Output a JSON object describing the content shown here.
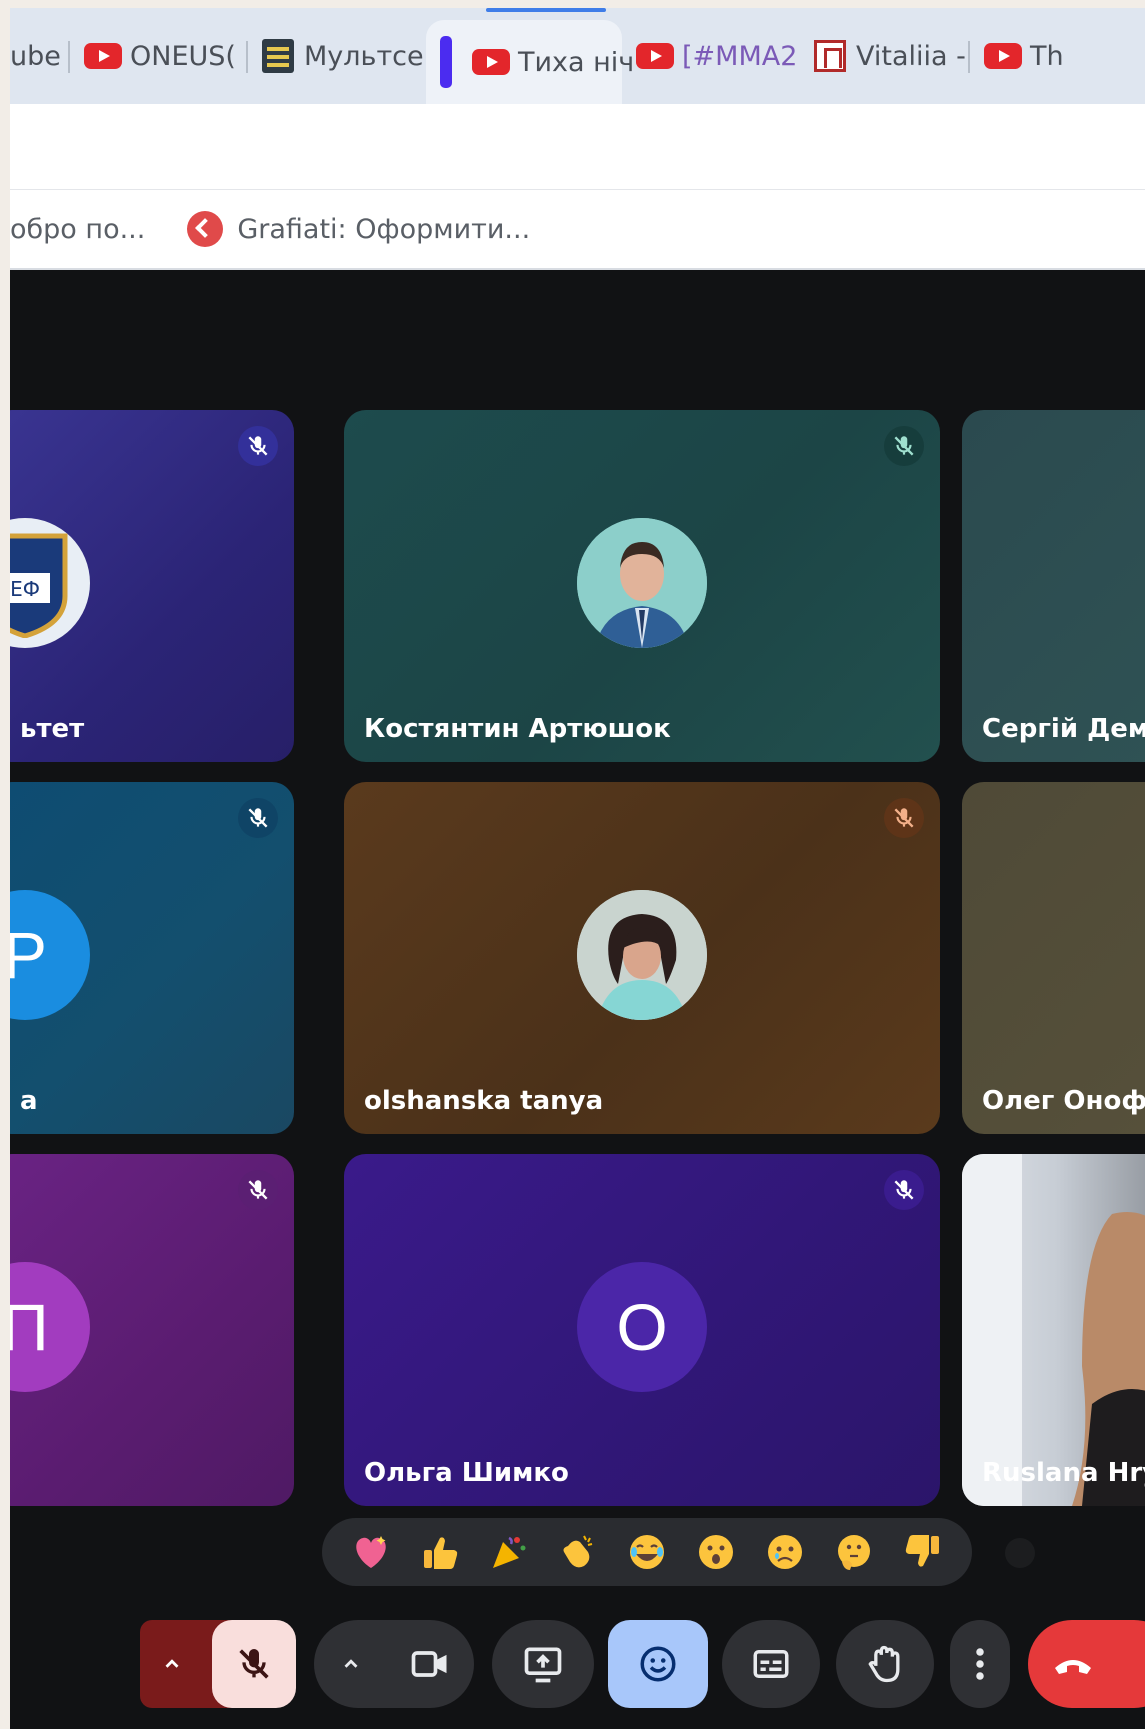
{
  "browser": {
    "tabs": [
      {
        "label": "ube",
        "icon": "none"
      },
      {
        "label": "ONEUS(",
        "icon": "youtube-icon"
      },
      {
        "label": "Мультсе",
        "icon": "doc-icon"
      },
      {
        "label": "Тиха ніч",
        "icon": "youtube-icon",
        "active": true
      },
      {
        "label": "[#MMA2",
        "icon": "youtube-icon"
      },
      {
        "label": "Vitaliia -",
        "icon": "vitaliia-icon"
      },
      {
        "label": "Th",
        "icon": "youtube-icon"
      }
    ],
    "bookmarks": [
      {
        "label": "обро по..."
      },
      {
        "label": "Grafiati: Оформити..."
      }
    ]
  },
  "meet": {
    "participants": [
      {
        "name": "ьтет",
        "avatar": "faculty-logo",
        "muted": true
      },
      {
        "name": "Костянтин Артюшок",
        "avatar": "photo",
        "muted": true
      },
      {
        "name": "Сергій Дем",
        "avatar": "none",
        "muted": true
      },
      {
        "name": "а",
        "avatar": "letter",
        "letter": "Р",
        "muted": true
      },
      {
        "name": "olshanska tanya",
        "avatar": "photo",
        "muted": true
      },
      {
        "name": "Олег Онофр",
        "avatar": "none",
        "muted": true
      },
      {
        "name": "",
        "avatar": "letter",
        "letter": "П",
        "muted": true
      },
      {
        "name": "Ольга Шимко",
        "avatar": "letter",
        "letter": "О",
        "muted": true
      },
      {
        "name": "Ruslana Hry",
        "avatar": "camera",
        "muted": false
      }
    ],
    "reactions": [
      "sparkling-heart",
      "thumbs-up",
      "party-popper",
      "clapping-hands",
      "joy",
      "astonished",
      "sad",
      "thinking",
      "thumbs-down"
    ],
    "colors": {
      "end_call": "#e5393a",
      "reactions_active": "#a8c7fa",
      "mic_muted_bg": "#f9dedc"
    }
  }
}
